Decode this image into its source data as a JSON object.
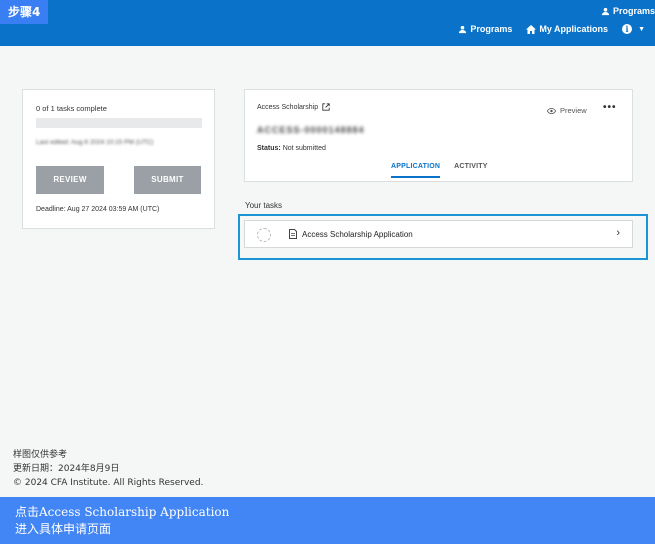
{
  "step_tag": "步骤4",
  "topbar": {
    "cut_label": "Programs",
    "nav": {
      "programs": "Programs",
      "my_applications": "My Applications"
    }
  },
  "left_card": {
    "progress_text": "0 of 1 tasks complete",
    "last_edited": "Last edited: Aug 8 2024 10:15 PM (UTC)",
    "review_label": "REVIEW",
    "submit_label": "SUBMIT",
    "deadline": "Deadline: Aug 27 2024 03:59 AM (UTC)"
  },
  "application": {
    "program_name": "Access Scholarship",
    "preview_label": "Preview",
    "more_label": "•••",
    "application_id": "ACCESS-0000148884",
    "status_label": "Status:",
    "status_value": "Not submitted",
    "tabs": [
      {
        "label": "APPLICATION",
        "active": true
      },
      {
        "label": "ACTIVITY",
        "active": false
      }
    ]
  },
  "tasks": {
    "heading": "Your tasks",
    "items": [
      {
        "label": "Access Scholarship Application"
      }
    ]
  },
  "footer": {
    "line1": "样图仅供参考",
    "line2": "更新日期：2024年8月9日",
    "line3": "© 2024 CFA Institute. All Rights Reserved."
  },
  "banner": {
    "line1": "点击Access Scholarship Application",
    "line2": "进入具体申请页面"
  },
  "colors": {
    "topbar": "#0a73c9",
    "step_tag": "#3a7ef4",
    "banner": "#4285f4",
    "highlight": "#1c95d6"
  }
}
